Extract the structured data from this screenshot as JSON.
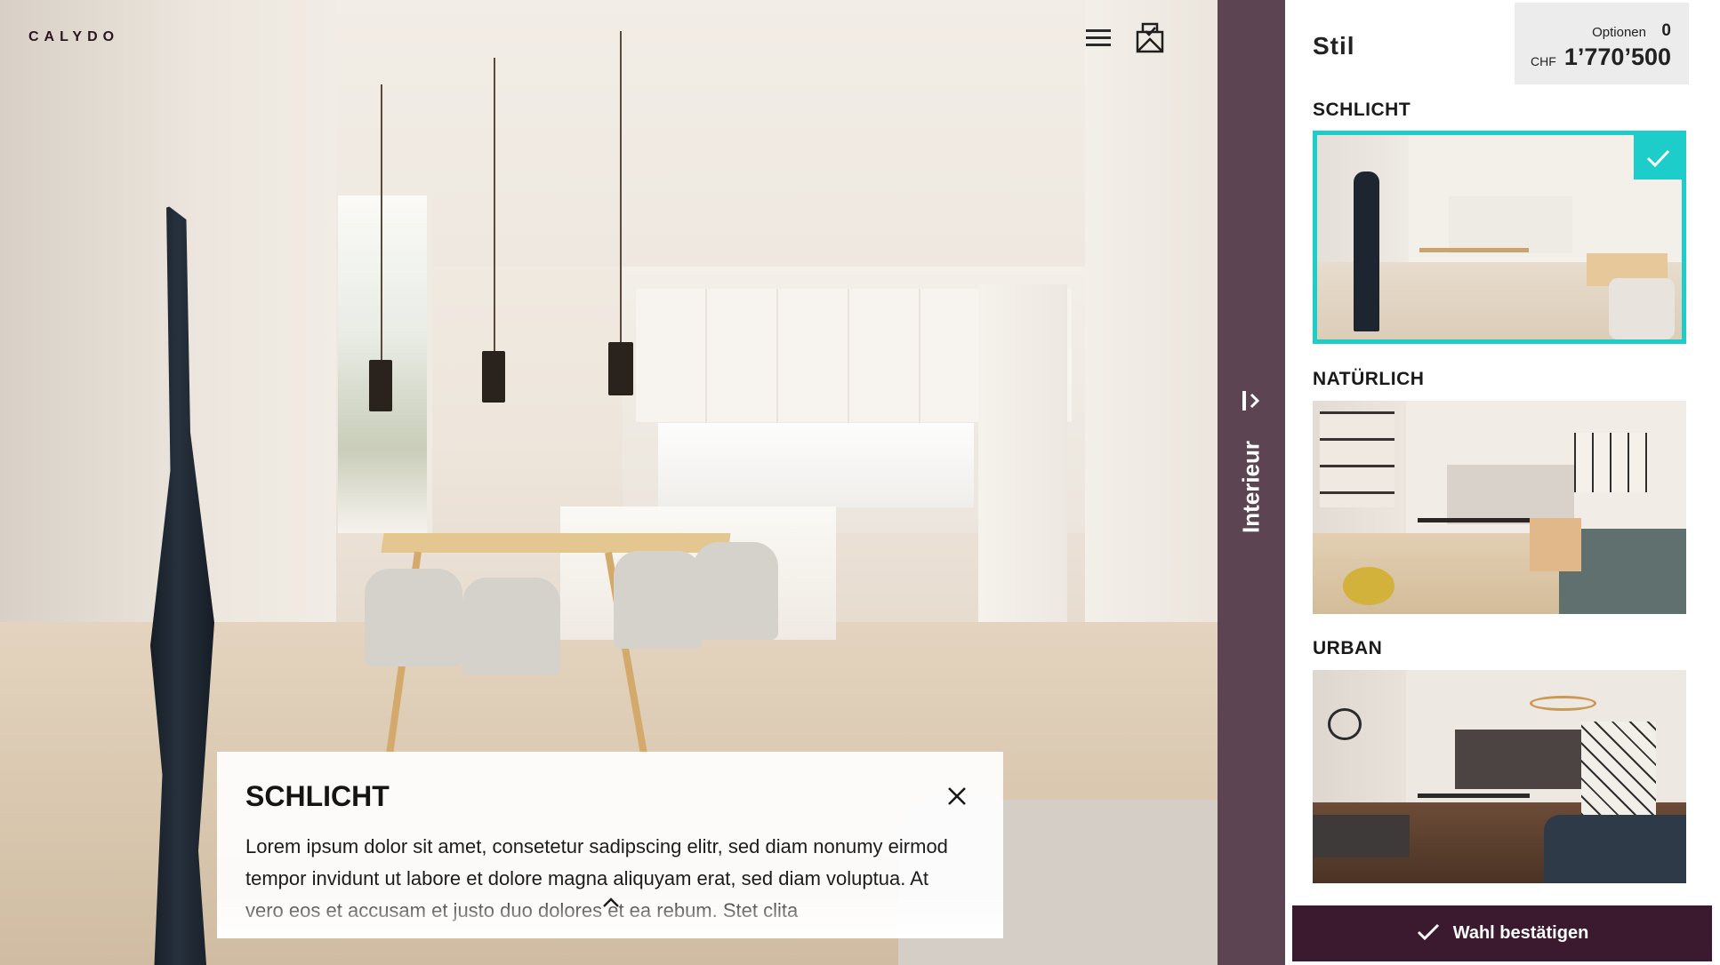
{
  "brand": {
    "logo_text": "CALYDO"
  },
  "header": {
    "menu_icon": "hamburger-menu-icon",
    "mail_icon": "mail-check-icon"
  },
  "info_card": {
    "title": "SCHLICHT",
    "text": "Lorem ipsum dolor sit amet, consetetur sadipscing elitr, sed diam nonumy eirmod tempor invidunt ut labore et dolore magna aliquyam erat, sed diam voluptua. At vero eos et accusam et justo duo dolores et ea rebum. Stet clita",
    "close_icon": "close-icon",
    "expand_icon": "chevron-up-icon"
  },
  "side_tab": {
    "label": "Interieur",
    "icon": "collapse-panel-icon"
  },
  "panel": {
    "title": "Stil",
    "options_label": "Optionen",
    "options_count": "0",
    "currency": "CHF",
    "price": "1’770’500"
  },
  "styles": [
    {
      "label": "SCHLICHT",
      "selected": true
    },
    {
      "label": "NATÜRLICH",
      "selected": false
    },
    {
      "label": "URBAN",
      "selected": false
    }
  ],
  "confirm": {
    "label": "Wahl bestätigen",
    "icon": "checkmark-icon"
  },
  "colors": {
    "accent": "#1ccdc9",
    "tab_bg": "#5c4453",
    "button_bg": "#3b1a30"
  }
}
